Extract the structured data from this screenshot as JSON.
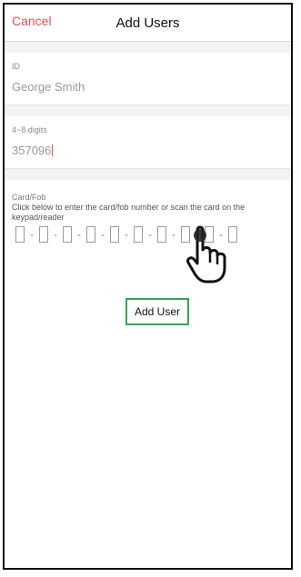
{
  "nav": {
    "cancel_label": "Cancel",
    "title": "Add Users"
  },
  "id_field": {
    "label": "ID",
    "value": "George Smith"
  },
  "pin_field": {
    "label": "4~8 digits",
    "value": "357096"
  },
  "card_field": {
    "label": "Card/Fob",
    "instructions": "Click below to enter the card/fob number or scan the card on the keypad/reader",
    "digit_count": 10
  },
  "actions": {
    "add_user_label": "Add User"
  },
  "icons": {
    "pointer": "hand-pointer-icon"
  },
  "colors": {
    "cancel": "#e8514a",
    "button_border": "#2fa84f"
  }
}
